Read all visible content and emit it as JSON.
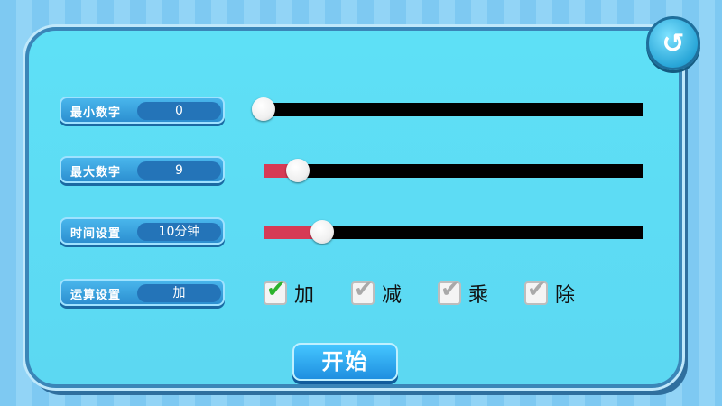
{
  "colors": {
    "panel": "#5ee0f6",
    "label_pill": "#2c8fd0",
    "slider_fill": "#d63a55",
    "check_active": "#2db32d",
    "check_inactive": "#a9a9a9"
  },
  "back_button": {
    "icon": "back-arrow-icon",
    "glyph": "↺"
  },
  "settings": [
    {
      "label": "最小数字",
      "value": "0"
    },
    {
      "label": "最大数字",
      "value": "9"
    },
    {
      "label": "时间设置",
      "value": "10分钟"
    },
    {
      "label": "运算设置",
      "value": "加"
    }
  ],
  "sliders": [
    {
      "name": "min",
      "fraction": 0.0
    },
    {
      "name": "max",
      "fraction": 0.09
    },
    {
      "name": "time",
      "fraction": 0.155
    }
  ],
  "operations": [
    {
      "label": "加",
      "checked": true
    },
    {
      "label": "减",
      "checked": false
    },
    {
      "label": "乘",
      "checked": false
    },
    {
      "label": "除",
      "checked": false
    }
  ],
  "start_button": {
    "label": "开始"
  }
}
